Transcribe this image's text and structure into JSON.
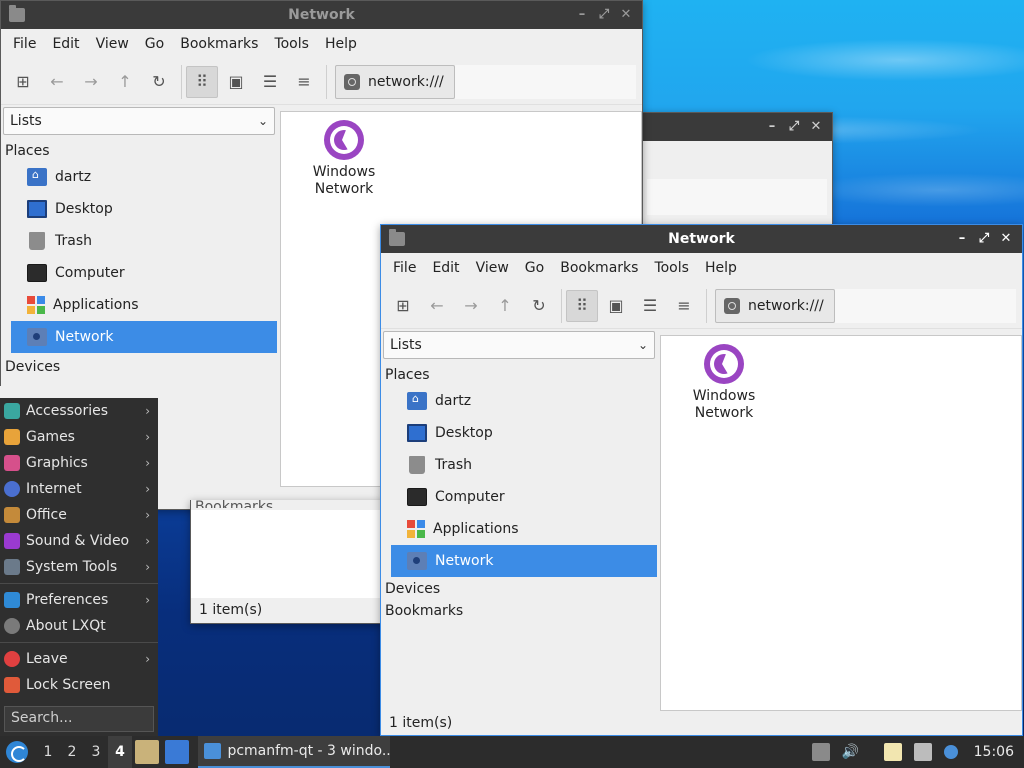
{
  "window_title": "Network",
  "menu": [
    "File",
    "Edit",
    "View",
    "Go",
    "Bookmarks",
    "Tools",
    "Help"
  ],
  "path": "network:///",
  "side_combo": "Lists",
  "places_heading": "Places",
  "places": [
    {
      "label": "dartz",
      "icon": "home-folder-icon"
    },
    {
      "label": "Desktop",
      "icon": "desktop-icon"
    },
    {
      "label": "Trash",
      "icon": "trash-icon"
    },
    {
      "label": "Computer",
      "icon": "computer-icon"
    },
    {
      "label": "Applications",
      "icon": "applications-icon"
    },
    {
      "label": "Network",
      "icon": "network-icon",
      "selected": true
    }
  ],
  "devices_heading": "Devices",
  "bookmarks_heading": "Bookmarks",
  "file_item": {
    "line1": "Windows",
    "line2": "Network",
    "icon": "windows-network-icon"
  },
  "status": "1 item(s)",
  "back_window": {
    "bookmarks_partial": "Bookmarks",
    "status": "1 item(s)"
  },
  "start_menu": {
    "items": [
      {
        "label": "Accessories",
        "color": "#3aa7a0",
        "submenu": true
      },
      {
        "label": "Games",
        "color": "#e8a33a",
        "submenu": true
      },
      {
        "label": "Graphics",
        "color": "#d6508b",
        "submenu": true
      },
      {
        "label": "Internet",
        "color": "#4a6fd0",
        "submenu": true
      },
      {
        "label": "Office",
        "color": "#c48a3a",
        "submenu": true
      },
      {
        "label": "Sound & Video",
        "color": "#9a3ad0",
        "submenu": true
      },
      {
        "label": "System Tools",
        "color": "#6b7a8a",
        "submenu": true
      }
    ],
    "items2": [
      {
        "label": "Preferences",
        "color": "#2f8ad6",
        "submenu": true
      },
      {
        "label": "About LXQt",
        "color": "#7a7a7a",
        "submenu": false
      }
    ],
    "items3": [
      {
        "label": "Leave",
        "color": "#e04040",
        "submenu": true
      },
      {
        "label": "Lock Screen",
        "color": "#e05a3a",
        "submenu": false
      }
    ],
    "search_placeholder": "Search..."
  },
  "panel": {
    "desktops": [
      "1",
      "2",
      "3",
      "4"
    ],
    "current_desktop": "4",
    "task_label": "pcmanfm-qt - 3 windo...",
    "clock": "15:06"
  },
  "colors": {
    "accent": "#3c8ce6",
    "panel": "#2c2c2c",
    "titlebar": "#3b3b3b"
  }
}
